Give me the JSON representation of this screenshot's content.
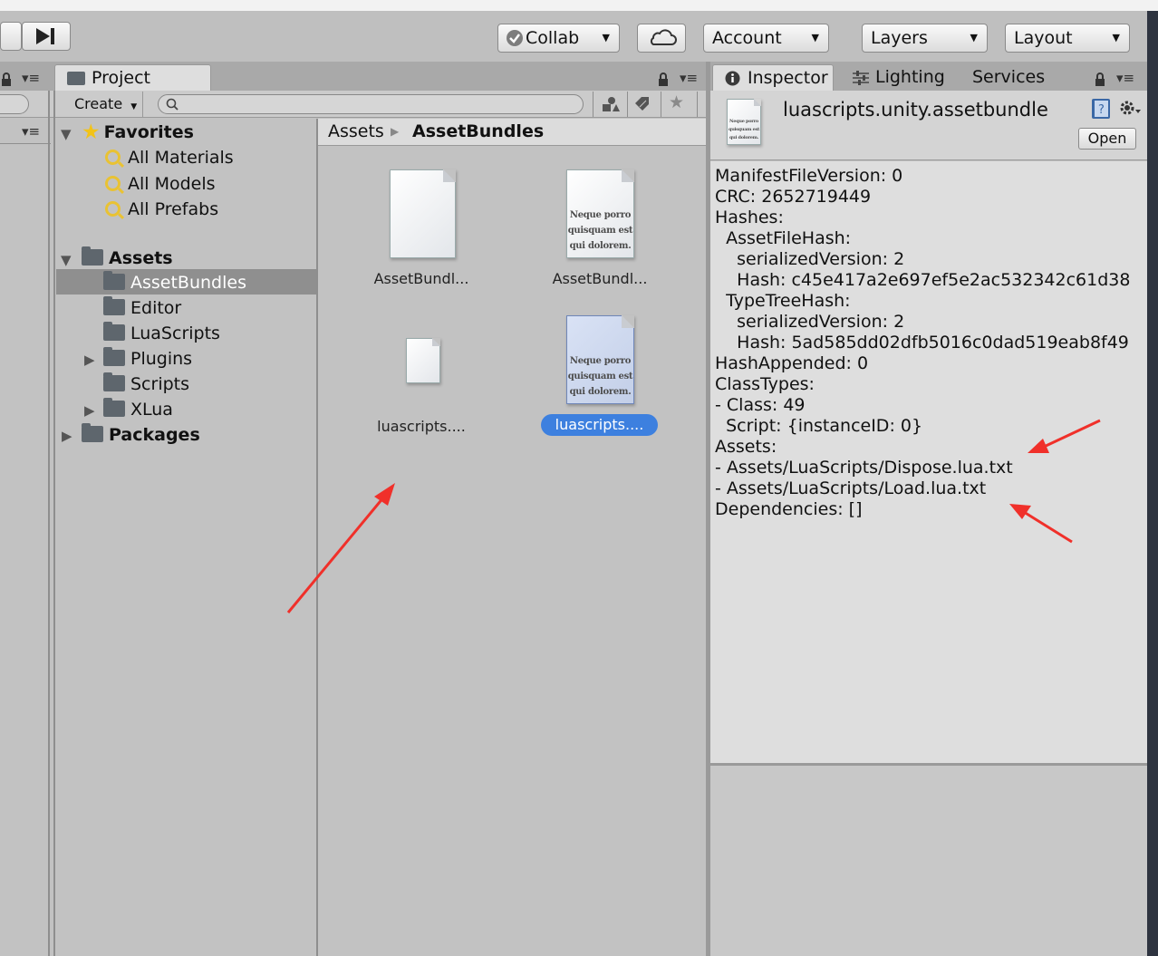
{
  "toolbar": {
    "collab": "Collab",
    "account": "Account",
    "layers": "Layers",
    "layout": "Layout"
  },
  "project": {
    "tab": "Project",
    "create": "Create",
    "favorites": {
      "label": "Favorites",
      "items": [
        "All Materials",
        "All Models",
        "All Prefabs"
      ]
    },
    "assets_root": "Assets",
    "asset_folders": [
      "AssetBundles",
      "Editor",
      "LuaScripts",
      "Plugins",
      "Scripts",
      "XLua"
    ],
    "packages": "Packages",
    "breadcrumb": [
      "Assets",
      "AssetBundles"
    ],
    "grid_items": [
      "AssetBundl...",
      "AssetBundl...",
      "luascripts....",
      "luascripts...."
    ],
    "doc_preview_text": [
      "Neque porro",
      "quisquam est",
      "qui dolorem."
    ]
  },
  "inspector": {
    "tabs": [
      "Inspector",
      "Lighting",
      "Services"
    ],
    "title": "luascripts.unity.assetbundle",
    "open_button": "Open",
    "manifest_lines": [
      "ManifestFileVersion: 0",
      "CRC: 2652719449",
      "Hashes:",
      "  AssetFileHash:",
      "    serializedVersion: 2",
      "    Hash: c45e417a2e697ef5e2ac532342c61d38",
      "  TypeTreeHash:",
      "    serializedVersion: 2",
      "    Hash: 5ad585dd02dfb5016c0dad519eab8f49",
      "HashAppended: 0",
      "ClassTypes:",
      "- Class: 49",
      "  Script: {instanceID: 0}",
      "Assets:",
      "- Assets/LuaScripts/Dispose.lua.txt",
      "- Assets/LuaScripts/Load.lua.txt",
      "Dependencies: []"
    ]
  },
  "colors": {
    "selection": "#3d80df",
    "tree_selection": "#8f8f8f",
    "annotation_arrow": "#f0302a",
    "panel_bg": "#c2c2c2",
    "inspector_bg": "#dedede"
  }
}
